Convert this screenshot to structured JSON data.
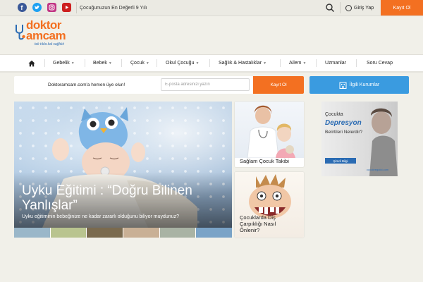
{
  "topbar": {
    "social": [
      {
        "icon": "facebook-icon",
        "color": "#3b5998"
      },
      {
        "icon": "twitter-icon",
        "color": "#1da1f2"
      },
      {
        "icon": "instagram-icon",
        "color": "#c13584"
      },
      {
        "icon": "youtube-icon",
        "color": "#cd201f"
      }
    ],
    "news_text": "Çocuğunuzun En Değerli 9 Yılı",
    "login_label": "Giriş Yap",
    "register_label": "Kayıt Ol"
  },
  "logo": {
    "line1": "doktor",
    "line2": "amcam",
    "tagline": "tek tıkla kal sağlıklı"
  },
  "nav": {
    "items": [
      {
        "label": "Gebelik",
        "has_dropdown": true
      },
      {
        "label": "Bebek",
        "has_dropdown": true
      },
      {
        "label": "Çocuk",
        "has_dropdown": true
      },
      {
        "label": "Okul Çocuğu",
        "has_dropdown": true
      },
      {
        "label": "Sağlık & Hastalıklar",
        "has_dropdown": true
      },
      {
        "label": "Ailem",
        "has_dropdown": true
      },
      {
        "label": "Uzmanlar",
        "has_dropdown": false
      },
      {
        "label": "Soru Cevap",
        "has_dropdown": false
      }
    ]
  },
  "subscribe": {
    "text": "Doktoramcam.com'a hemen üye olun!",
    "placeholder": "E-posta adresinizi yazın",
    "button": "Kayıt Ol",
    "institutions_button": "İlgili Kurumlar"
  },
  "hero": {
    "title": "Uyku Eğitimi : “Doğru Bilinen Yanlışlar”",
    "subtitle": "Uyku eğitiminin bebeğinize ne kadar zararlı olduğunu biliyor muydunuz?"
  },
  "cards": [
    {
      "title": "Sağlam Çocuk Takibi"
    },
    {
      "title": "Çocuklarda Diş Çarpıklığı Nasıl Önlenir?"
    }
  ],
  "ad": {
    "line1": "Çocukta",
    "line2": "Depresyon",
    "line3": "Belirtileri Nelerdir?",
    "button": "Şimdi Bilgi",
    "source": "cocukregatci.com"
  },
  "colors": {
    "accent": "#f37021",
    "blue": "#3a9be0",
    "background": "#f1f0e9"
  }
}
